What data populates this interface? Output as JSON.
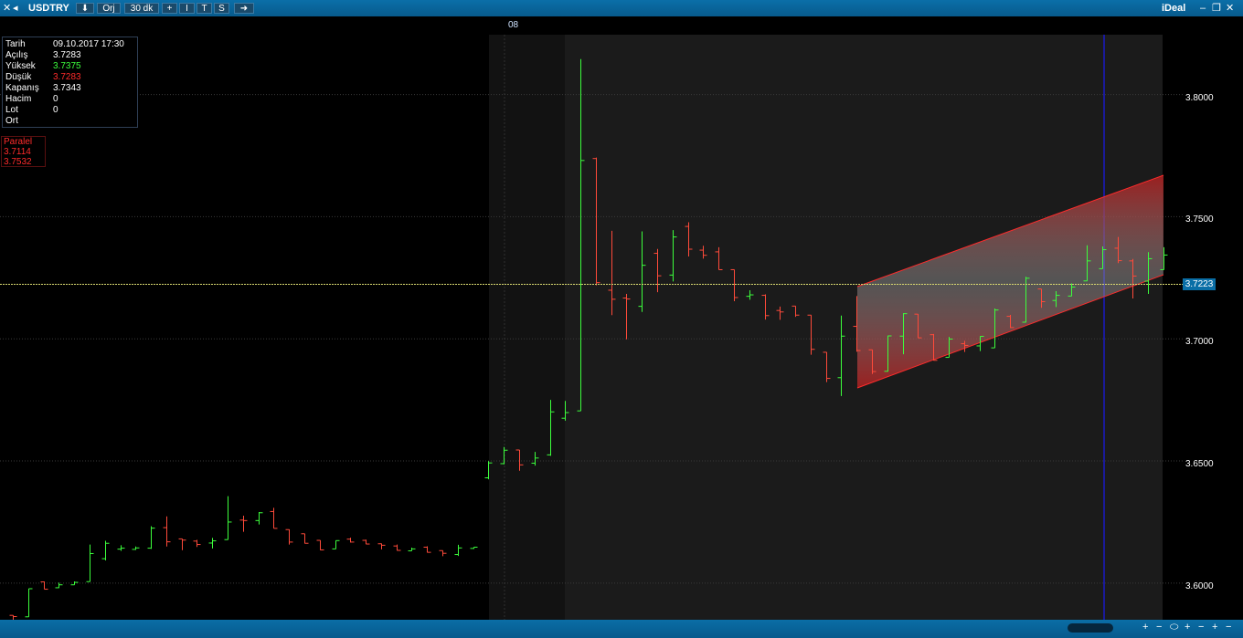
{
  "toolbar": {
    "symbol": "USDTRY",
    "orj_label": "Orj",
    "period_label": "30 dk",
    "plus_label": "+",
    "i_label": "I",
    "t_label": "T",
    "s_label": "S",
    "brand": "iDeal"
  },
  "x_axis": {
    "day_label": "08"
  },
  "info": {
    "rows": [
      {
        "label": "Tarih",
        "value": "09.10.2017 17:30",
        "color": "#ffffff"
      },
      {
        "label": "Açılış",
        "value": "3.7283",
        "color": "#ffffff"
      },
      {
        "label": "Yüksek",
        "value": "3.7375",
        "color": "#3cff3c"
      },
      {
        "label": "Düşük",
        "value": "3.7283",
        "color": "#ff2b2b"
      },
      {
        "label": "Kapanış",
        "value": "3.7343",
        "color": "#ffffff"
      },
      {
        "label": "Hacim",
        "value": "0",
        "color": "#ffffff"
      },
      {
        "label": "Lot",
        "value": "0",
        "color": "#ffffff"
      },
      {
        "label": "Ort",
        "value": "",
        "color": "#ffffff"
      }
    ]
  },
  "channel": {
    "title": "Paralel",
    "lower": "3.7114",
    "upper": "3.7532"
  },
  "price_axis": {
    "ticks": [
      "3.8000",
      "3.7500",
      "3.7000",
      "3.6500",
      "3.6000"
    ],
    "current": "3.7223"
  },
  "chart_data": {
    "type": "ohlc",
    "ylim": [
      3.585,
      3.8245
    ],
    "ticks": [
      3.8,
      3.75,
      3.7,
      3.65,
      3.6
    ],
    "current_price": 3.7223,
    "bars": [
      [
        3.5868,
        3.5863,
        3.5843,
        3.5863
      ],
      [
        3.5862,
        3.5977,
        3.5862,
        3.5977
      ],
      [
        3.6005,
        3.6007,
        3.5975,
        3.5975
      ],
      [
        3.5981,
        3.6002,
        3.598,
        3.5993
      ],
      [
        3.5993,
        3.6007,
        3.5995,
        3.6003
      ],
      [
        3.6006,
        3.6158,
        3.6006,
        3.6121
      ],
      [
        3.61,
        3.6173,
        3.6093,
        3.6163
      ],
      [
        3.6139,
        3.6155,
        3.6132,
        3.6143
      ],
      [
        3.6138,
        3.615,
        3.6136,
        3.6144
      ],
      [
        3.6143,
        3.6233,
        3.614,
        3.6225
      ],
      [
        3.6227,
        3.6273,
        3.615,
        3.6169
      ],
      [
        3.6181,
        3.6174,
        3.6135,
        3.6176
      ],
      [
        3.6172,
        3.6177,
        3.6148,
        3.6158
      ],
      [
        3.6164,
        3.6185,
        3.6142,
        3.6173
      ],
      [
        3.6178,
        3.6356,
        3.6224,
        3.625
      ],
      [
        3.6258,
        3.6276,
        3.621,
        3.6256
      ],
      [
        3.6256,
        3.6291,
        3.624,
        3.6288
      ],
      [
        3.6293,
        3.6308,
        3.6225,
        3.6224
      ],
      [
        3.6219,
        3.622,
        3.6158,
        3.6168
      ],
      [
        3.6202,
        3.6201,
        3.6162,
        3.6163
      ],
      [
        3.6175,
        3.6169,
        3.6135,
        3.6136
      ],
      [
        3.614,
        3.6173,
        3.6142,
        3.6174
      ],
      [
        3.618,
        3.6186,
        3.6166,
        3.6168
      ],
      [
        3.6175,
        3.6178,
        3.6159,
        3.616
      ],
      [
        3.6161,
        3.6162,
        3.6138,
        3.6155
      ],
      [
        3.6152,
        3.6158,
        3.6133,
        3.6134
      ],
      [
        3.6132,
        3.6145,
        3.6133,
        3.614
      ],
      [
        3.6147,
        3.6151,
        3.6125,
        3.6126
      ],
      [
        3.6133,
        3.6128,
        3.611,
        3.6122
      ],
      [
        3.6117,
        3.6157,
        3.6111,
        3.6144
      ],
      [
        3.6142,
        3.6146,
        3.614,
        3.6147
      ],
      [
        3.6431,
        3.6499,
        3.6425,
        3.6492
      ],
      [
        3.6489,
        3.6557,
        3.6486,
        3.6544
      ],
      [
        3.6545,
        3.6538,
        3.646,
        3.6484
      ],
      [
        3.6491,
        3.6537,
        3.6481,
        3.6512
      ],
      [
        3.6525,
        3.675,
        3.6521,
        3.6701
      ],
      [
        3.6675,
        3.6746,
        3.6665,
        3.6698
      ],
      [
        3.6705,
        3.8145,
        3.6706,
        3.773
      ],
      [
        3.7738,
        3.7742,
        3.7219,
        3.723
      ],
      [
        3.7199,
        3.7442,
        3.7097,
        3.7162
      ],
      [
        3.7167,
        3.7184,
        3.6998,
        3.7163
      ],
      [
        3.7133,
        3.744,
        3.711,
        3.7301
      ],
      [
        3.735,
        3.7368,
        3.7191,
        3.7258
      ],
      [
        3.7261,
        3.7445,
        3.7235,
        3.7417
      ],
      [
        3.746,
        3.7477,
        3.7337,
        3.7367
      ],
      [
        3.7363,
        3.7381,
        3.7328,
        3.7342
      ],
      [
        3.7356,
        3.7375,
        3.7283,
        3.7283
      ],
      [
        3.7283,
        3.7277,
        3.7154,
        3.7169
      ],
      [
        3.7174,
        3.7199,
        3.716,
        3.718
      ],
      [
        3.7178,
        3.7182,
        3.7079,
        3.7095
      ],
      [
        3.7116,
        3.7132,
        3.7078,
        3.711
      ],
      [
        3.7134,
        3.712,
        3.709,
        3.7097
      ],
      [
        3.7097,
        3.7087,
        3.6935,
        3.6957
      ],
      [
        3.6945,
        3.6938,
        3.6823,
        3.6838
      ],
      [
        3.6841,
        3.7095,
        3.6766,
        3.7011
      ],
      [
        3.7051,
        3.7175,
        3.6947,
        3.6952
      ],
      [
        3.6955,
        3.6949,
        3.6856,
        3.6866
      ],
      [
        3.6867,
        3.7013,
        3.6866,
        3.7012
      ],
      [
        3.7011,
        3.7105,
        3.6937,
        3.7103
      ],
      [
        3.7101,
        3.71,
        3.7003,
        3.7004
      ],
      [
        3.7017,
        3.702,
        3.6911,
        3.6912
      ],
      [
        3.6924,
        3.7008,
        3.6948,
        3.6999
      ],
      [
        3.698,
        3.6992,
        3.6946,
        3.6973
      ],
      [
        3.6971,
        3.7008,
        3.695,
        3.701
      ],
      [
        3.6963,
        3.7124,
        3.6975,
        3.7118
      ],
      [
        3.7092,
        3.7098,
        3.7044,
        3.7046
      ],
      [
        3.7068,
        3.7254,
        3.7067,
        3.7248
      ],
      [
        3.7204,
        3.7183,
        3.7127,
        3.7152
      ],
      [
        3.7157,
        3.7195,
        3.713,
        3.7178
      ],
      [
        3.7175,
        3.7227,
        3.7175,
        3.7212
      ],
      [
        3.7237,
        3.7383,
        3.7263,
        3.7319
      ],
      [
        3.7287,
        3.7378,
        3.7288,
        3.7365
      ],
      [
        3.7371,
        3.7417,
        3.731,
        3.732
      ],
      [
        3.7319,
        3.7327,
        3.7165,
        3.7257
      ],
      [
        3.7236,
        3.7355,
        3.7184,
        3.7328
      ],
      [
        3.7283,
        3.7375,
        3.7283,
        3.7343
      ]
    ]
  }
}
